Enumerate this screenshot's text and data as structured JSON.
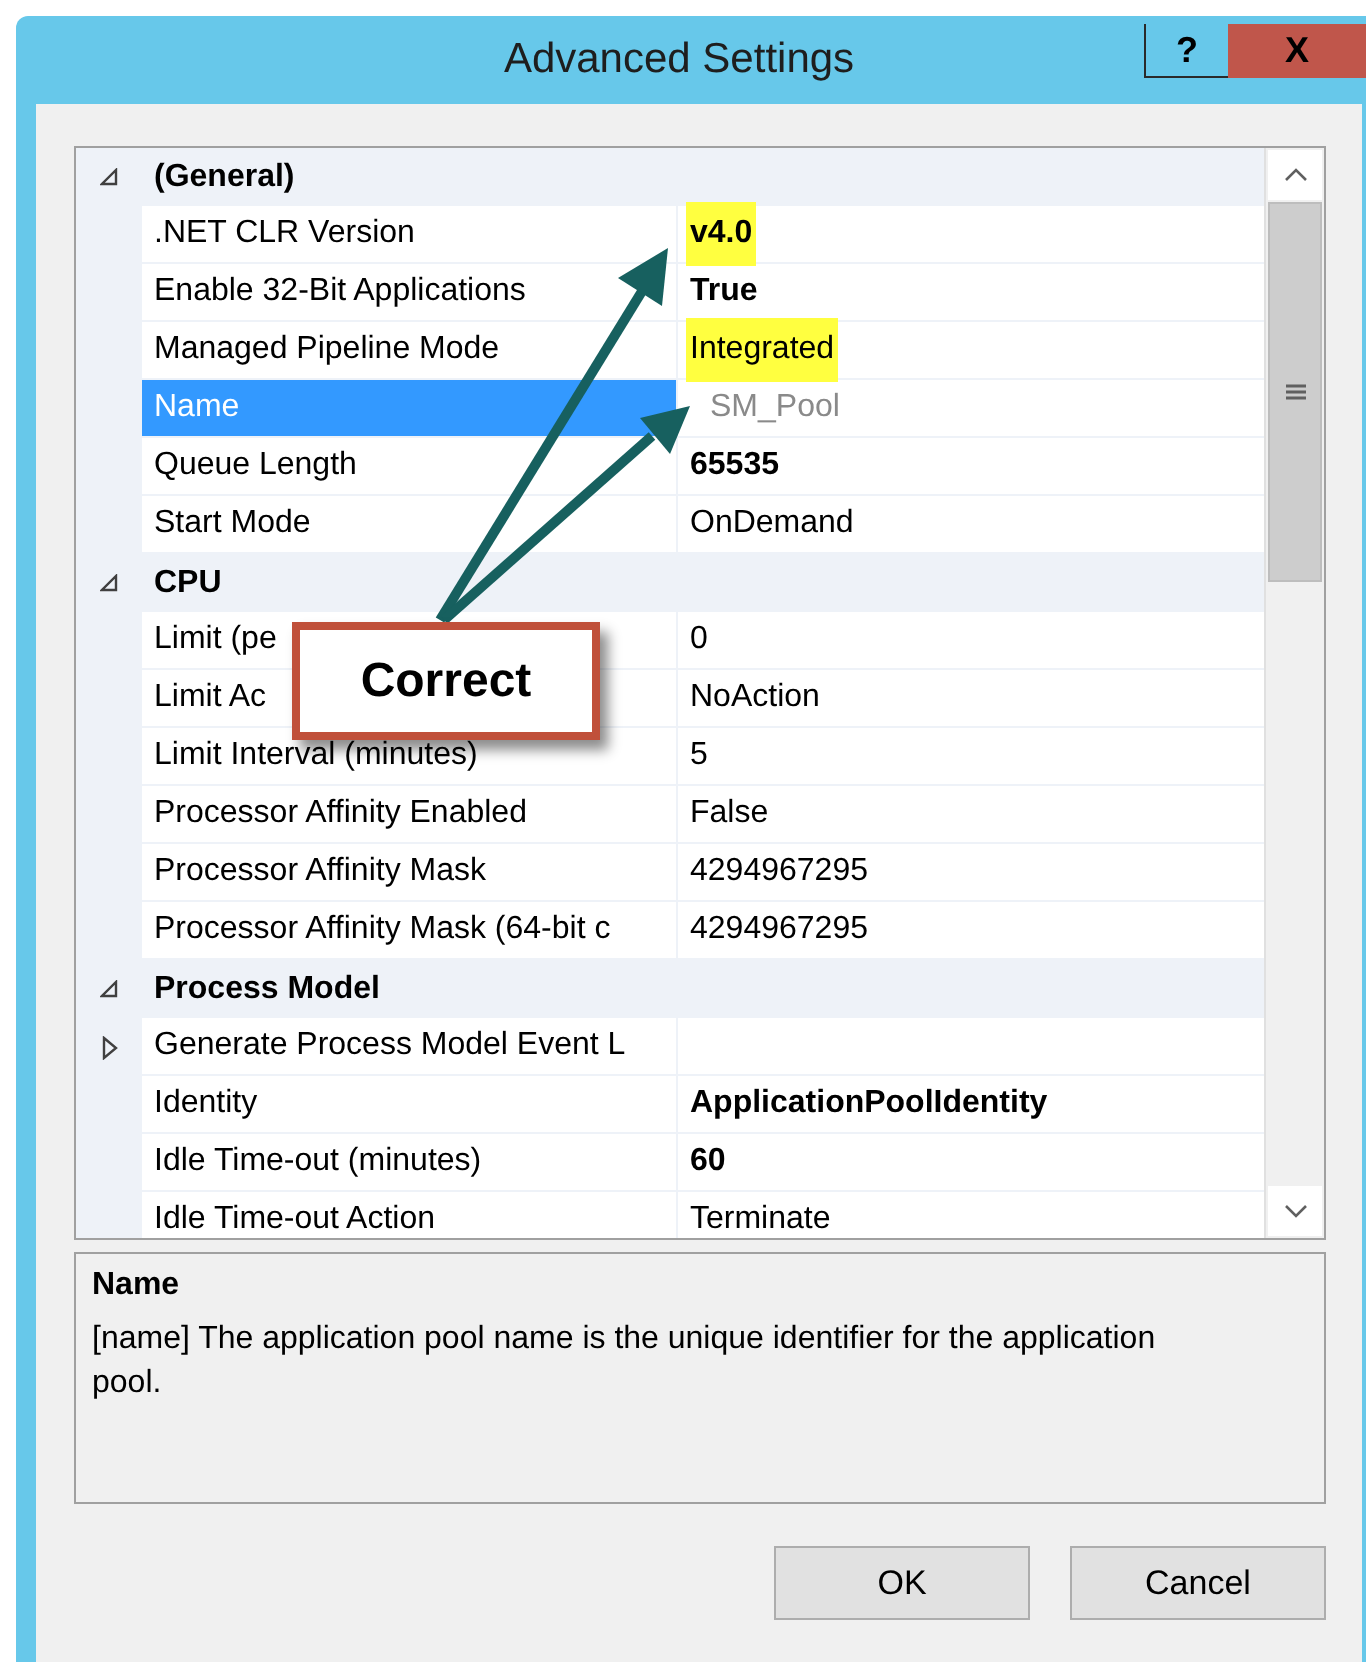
{
  "window": {
    "title": "Advanced Settings",
    "help_button": "?",
    "close_button": "X"
  },
  "property_grid": {
    "sections": [
      {
        "title": "(General)",
        "expanded": true,
        "properties": [
          {
            "name": ".NET CLR Version",
            "value": "v4.0",
            "bold": true,
            "highlighted": true,
            "selected": false,
            "grayed": false,
            "expandable": false
          },
          {
            "name": "Enable 32-Bit Applications",
            "value": "True",
            "bold": true,
            "highlighted": false,
            "selected": false,
            "grayed": false,
            "expandable": false
          },
          {
            "name": "Managed Pipeline Mode",
            "value": "Integrated",
            "bold": false,
            "highlighted": true,
            "selected": false,
            "grayed": false,
            "expandable": false
          },
          {
            "name": "Name",
            "value": "SM_Pool",
            "bold": false,
            "highlighted": false,
            "selected": true,
            "grayed": true,
            "expandable": false
          },
          {
            "name": "Queue Length",
            "value": "65535",
            "bold": true,
            "highlighted": false,
            "selected": false,
            "grayed": false,
            "expandable": false
          },
          {
            "name": "Start Mode",
            "value": "OnDemand",
            "bold": false,
            "highlighted": false,
            "selected": false,
            "grayed": false,
            "expandable": false
          }
        ]
      },
      {
        "title": "CPU",
        "expanded": true,
        "properties": [
          {
            "name": "Limit (pe",
            "value": "0",
            "bold": false,
            "highlighted": false,
            "selected": false,
            "grayed": false,
            "expandable": false
          },
          {
            "name": "Limit Ac",
            "value": "NoAction",
            "bold": false,
            "highlighted": false,
            "selected": false,
            "grayed": false,
            "expandable": false
          },
          {
            "name": "Limit Interval (minutes)",
            "value": "5",
            "bold": false,
            "highlighted": false,
            "selected": false,
            "grayed": false,
            "expandable": false
          },
          {
            "name": "Processor Affinity Enabled",
            "value": "False",
            "bold": false,
            "highlighted": false,
            "selected": false,
            "grayed": false,
            "expandable": false
          },
          {
            "name": "Processor Affinity Mask",
            "value": "4294967295",
            "bold": false,
            "highlighted": false,
            "selected": false,
            "grayed": false,
            "expandable": false
          },
          {
            "name": "Processor Affinity Mask (64-bit c",
            "value": "4294967295",
            "bold": false,
            "highlighted": false,
            "selected": false,
            "grayed": false,
            "expandable": false
          }
        ]
      },
      {
        "title": "Process Model",
        "expanded": true,
        "properties": [
          {
            "name": "Generate Process Model Event L",
            "selected": false,
            "expandable": true
          },
          {
            "name": "Identity",
            "value": "ApplicationPoolIdentity",
            "bold": true,
            "highlighted": false,
            "selected": false,
            "grayed": false,
            "expandable": false
          },
          {
            "name": "Idle Time-out (minutes)",
            "value": "60",
            "bold": true,
            "highlighted": false,
            "selected": false,
            "grayed": false,
            "expandable": false
          },
          {
            "name": "Idle Time-out Action",
            "value": "Terminate",
            "bold": false,
            "highlighted": false,
            "selected": false,
            "grayed": false,
            "expandable": false
          }
        ]
      }
    ]
  },
  "description": {
    "title": "Name",
    "text": "[name] The application pool name is the unique identifier for the application pool."
  },
  "buttons": [
    "OK",
    "Cancel"
  ],
  "callout": {
    "text": "Correct"
  }
}
